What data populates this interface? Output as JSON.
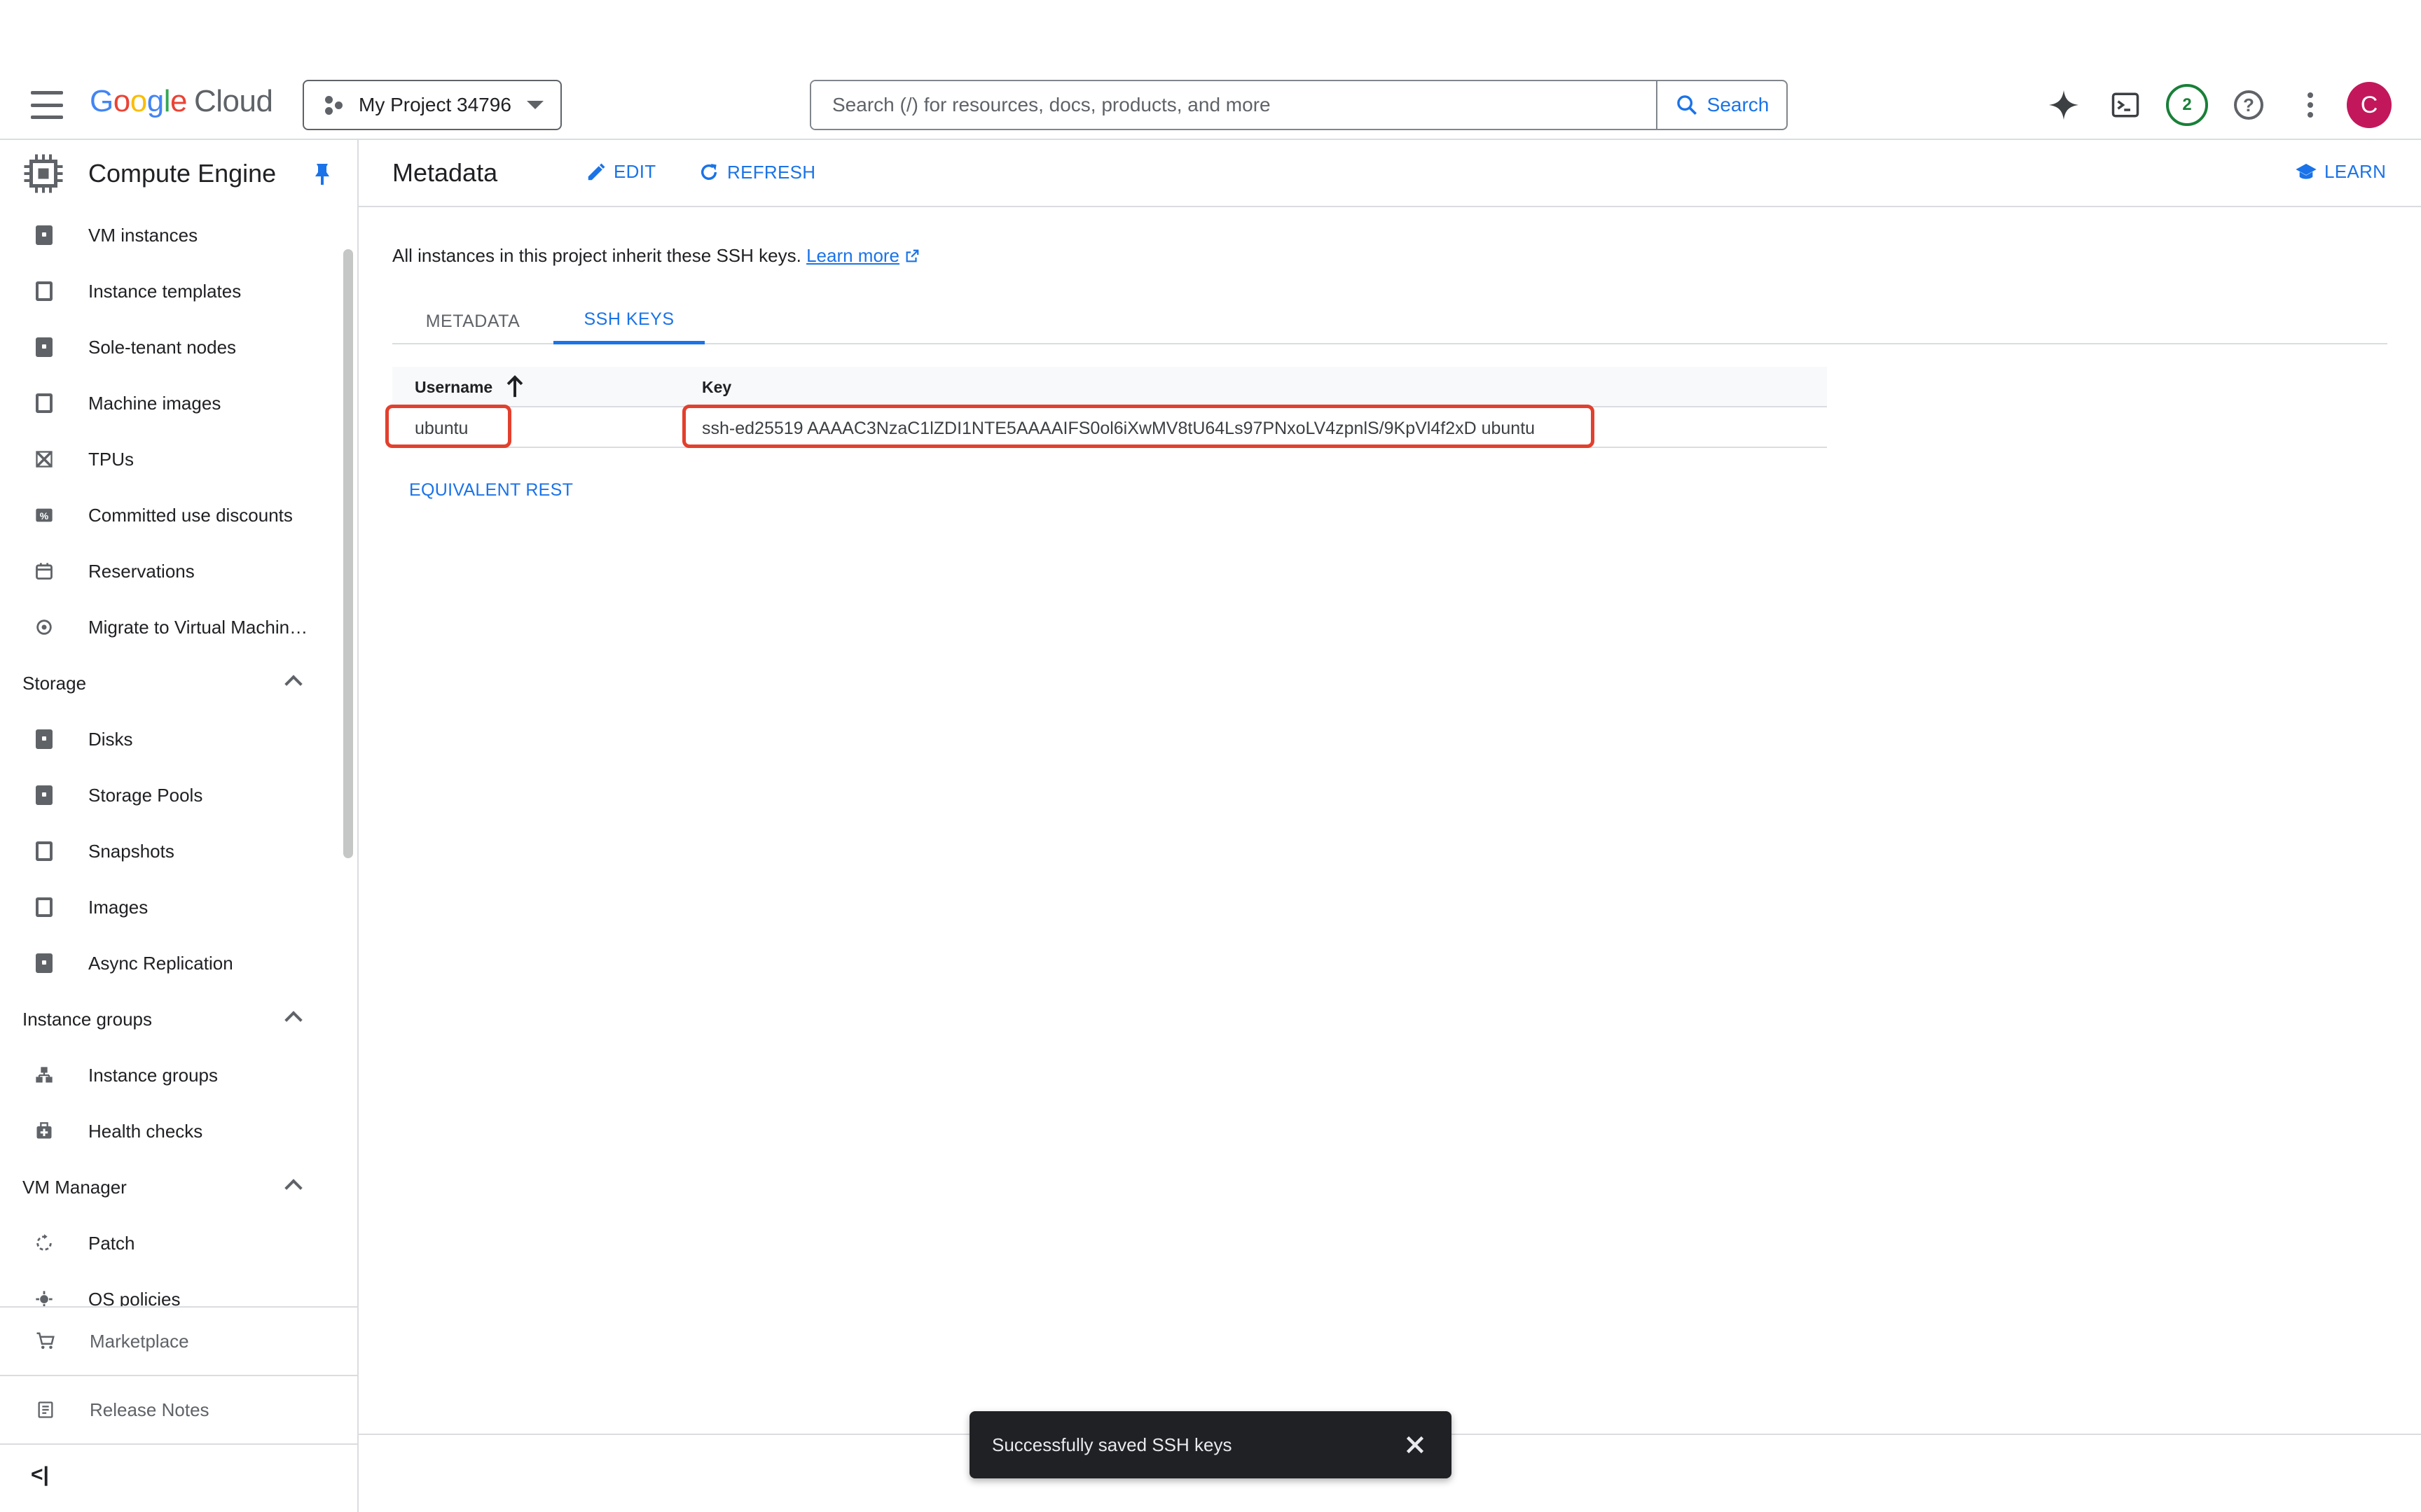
{
  "topbar": {
    "logo_letters": [
      "G",
      "o",
      "o",
      "g",
      "l",
      "e"
    ],
    "logo_suffix": "Cloud",
    "project_name": "My Project 34796",
    "search_placeholder": "Search (/) for resources, docs, products, and more",
    "search_button": "Search",
    "notifications_count": "2",
    "avatar_letter": "C"
  },
  "sidebar": {
    "product_title": "Compute Engine",
    "items": [
      {
        "label": "VM instances",
        "icon": "vm-instances-icon"
      },
      {
        "label": "Instance templates",
        "icon": "instance-templates-icon"
      },
      {
        "label": "Sole-tenant nodes",
        "icon": "sole-tenant-nodes-icon"
      },
      {
        "label": "Machine images",
        "icon": "machine-images-icon"
      },
      {
        "label": "TPUs",
        "icon": "tpus-icon"
      },
      {
        "label": "Committed use discounts",
        "icon": "discount-icon"
      },
      {
        "label": "Reservations",
        "icon": "calendar-icon"
      },
      {
        "label": "Migrate to Virtual Machin…",
        "icon": "migrate-icon"
      }
    ],
    "storage": {
      "section": "Storage",
      "items": [
        {
          "label": "Disks",
          "icon": "disks-icon"
        },
        {
          "label": "Storage Pools",
          "icon": "storage-pools-icon"
        },
        {
          "label": "Snapshots",
          "icon": "snapshots-icon"
        },
        {
          "label": "Images",
          "icon": "images-icon"
        },
        {
          "label": "Async Replication",
          "icon": "async-replication-icon"
        }
      ]
    },
    "instance_groups": {
      "section": "Instance groups",
      "items": [
        {
          "label": "Instance groups",
          "icon": "instance-groups-icon"
        },
        {
          "label": "Health checks",
          "icon": "health-checks-icon"
        }
      ]
    },
    "vm_manager": {
      "section": "VM Manager",
      "items": [
        {
          "label": "Patch",
          "icon": "patch-icon"
        },
        {
          "label": "OS policies",
          "icon": "os-policies-icon"
        }
      ]
    },
    "marketplace": "Marketplace",
    "release_notes": "Release Notes",
    "collapse": "<|"
  },
  "main": {
    "title": "Metadata",
    "edit": "EDIT",
    "refresh": "REFRESH",
    "learn": "LEARN",
    "info_text": "All instances in this project inherit these SSH keys.",
    "learn_more": "Learn more",
    "tabs": [
      "METADATA",
      "SSH KEYS"
    ],
    "active_tab": "SSH KEYS",
    "table": {
      "headers": {
        "username": "Username",
        "key": "Key"
      },
      "rows": [
        {
          "username": "ubuntu",
          "key": "ssh-ed25519 AAAAC3NzaC1lZDI1NTE5AAAAIFS0ol6iXwMV8tU64Ls97PNxoLV4zpnlS/9KpVl4f2xD ubuntu"
        }
      ]
    },
    "equivalent_rest": "EQUIVALENT REST"
  },
  "snackbar": {
    "message": "Successfully saved SSH keys"
  },
  "colors": {
    "accent": "#1a73e8",
    "highlight": "#e2402e",
    "avatar": "#c2185b",
    "badge": "#188038"
  }
}
